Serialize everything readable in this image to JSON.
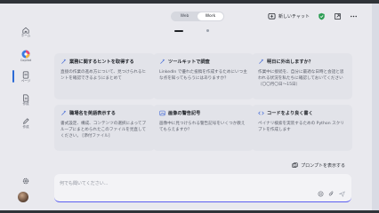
{
  "header": {
    "mode_web": "Web",
    "mode_work": "Work",
    "new_chat": "新しいチャット"
  },
  "sidebar": {
    "items": [
      {
        "label": "ホーム"
      },
      {
        "label": "Copilot"
      },
      {
        "label": "ページ"
      },
      {
        "label": "作成"
      },
      {
        "label": "作成"
      }
    ]
  },
  "cards": [
    {
      "title": "業務に関するヒントを取得する",
      "body": "直接の作業の進め方について、見つけられるヒントを確認できるようにまとめて"
    },
    {
      "title": "ツールキットで調査",
      "body": "LinkedIn で優れた投稿を作成するためにいつ主な点を知ってもらうにはありますか？"
    },
    {
      "title": "明日に外出しますか？",
      "body": "作業中に接続を、自分に最適な日時と会話と思われる状況を私たちに確認しておいてください（〇〇月〇日～15日）"
    },
    {
      "title": "職場名を英語表示する",
      "body": "書式設定、構成、コンテンツの選択によってブループにまとめられたこのファイルを見直してください。 [添付ファイル]"
    },
    {
      "title": "画像の警告記号",
      "body": "画像中に見つけられる警告記号をいくつか教えてもらえますか？"
    },
    {
      "title": "コードをより良く書く",
      "body": "ペイナリ検索を実装するための Python スクリプトを作成します"
    }
  ],
  "prompts_label": "プロンプトを表示する",
  "input": {
    "placeholder": "何でも聞いてください..."
  },
  "colors": {
    "accent": "#5b5ef0",
    "active": "#2c6bd6",
    "shield": "#2e9e55"
  }
}
